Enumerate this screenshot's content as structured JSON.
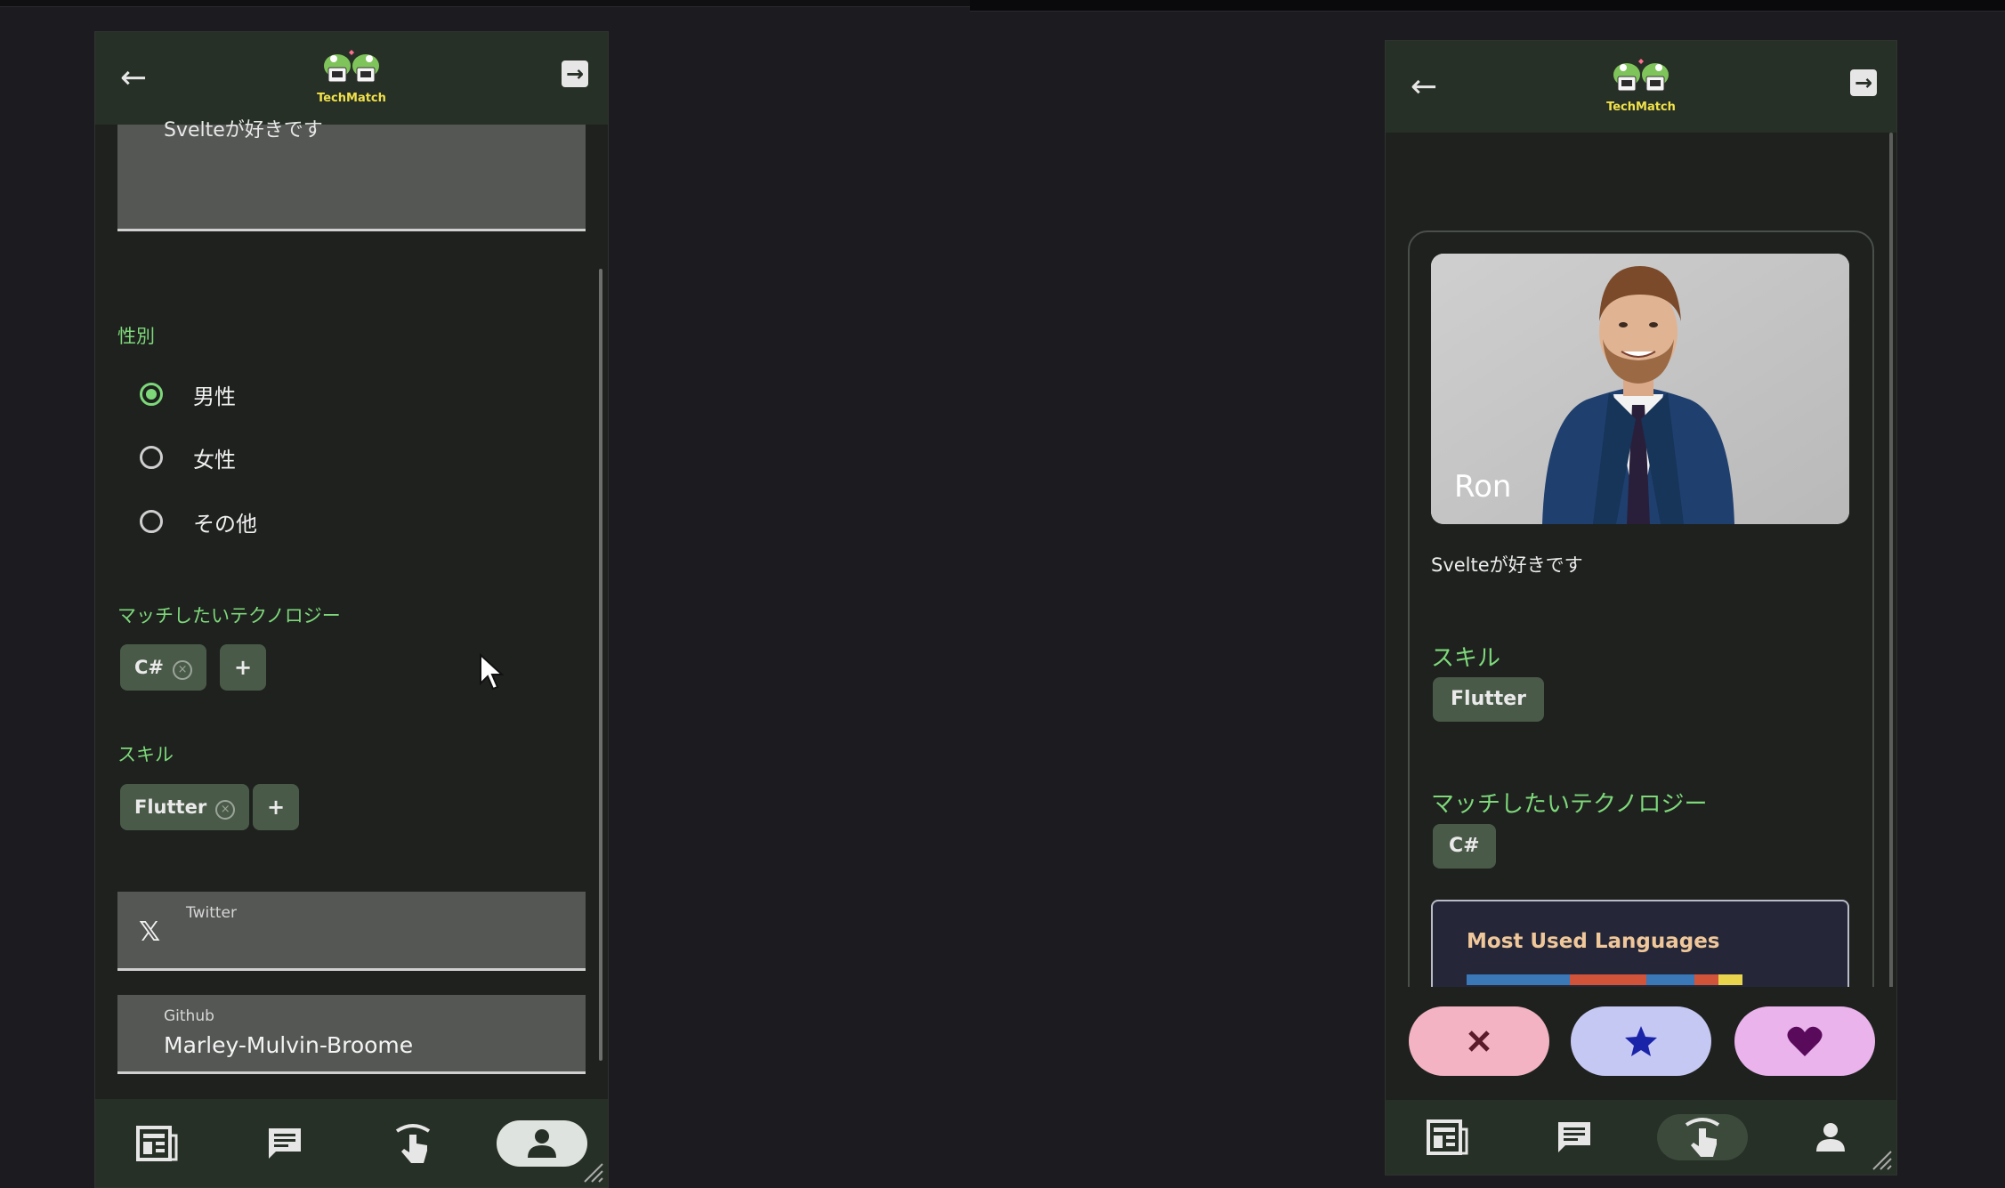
{
  "left_phone": {
    "logo_text": "TechMatch",
    "bio": "Svelteが好きです",
    "gender": {
      "label": "性別",
      "options": [
        "男性",
        "女性",
        "その他"
      ],
      "selected": "男性"
    },
    "match_tech": {
      "label": "マッチしたいテクノロジー",
      "chips": [
        "C#"
      ],
      "add": "+"
    },
    "skills": {
      "label": "スキル",
      "chips": [
        "Flutter"
      ],
      "add": "+"
    },
    "twitter": {
      "label": "Twitter",
      "value": ""
    },
    "github": {
      "label": "Github",
      "value": "Marley-Mulvin-Broome"
    },
    "nav_selected": "profile"
  },
  "right_phone": {
    "logo_text": "TechMatch",
    "name": "Ron",
    "bio": "Svelteが好きです",
    "skills": {
      "label": "スキル",
      "chips": [
        "Flutter"
      ]
    },
    "match_tech": {
      "label": "マッチしたいテクノロジー",
      "chips": [
        "C#"
      ]
    },
    "languages": {
      "title": "Most Used Languages",
      "segments": [
        {
          "color": "#3a78b8",
          "share": 0.3
        },
        {
          "color": "#d0533a",
          "share": 0.22
        },
        {
          "color": "#3a78b8",
          "share": 0.14
        },
        {
          "color": "#d0533a",
          "share": 0.07
        },
        {
          "color": "#e8d44d",
          "share": 0.07
        }
      ]
    },
    "actions": [
      {
        "name": "nope",
        "icon": "close-icon",
        "bg": "#f3b3c3",
        "fg": "#5a1a2a"
      },
      {
        "name": "super-like",
        "icon": "star-icon",
        "bg": "#c6c8f4",
        "fg": "#1a24a8"
      },
      {
        "name": "like",
        "icon": "heart-icon",
        "bg": "#eab3ec",
        "fg": "#5a0a5a"
      }
    ],
    "nav_selected": "swipe"
  },
  "colors": {
    "accent": "#7ed87a",
    "appbar": "#273027",
    "background": "#1c1b20"
  }
}
